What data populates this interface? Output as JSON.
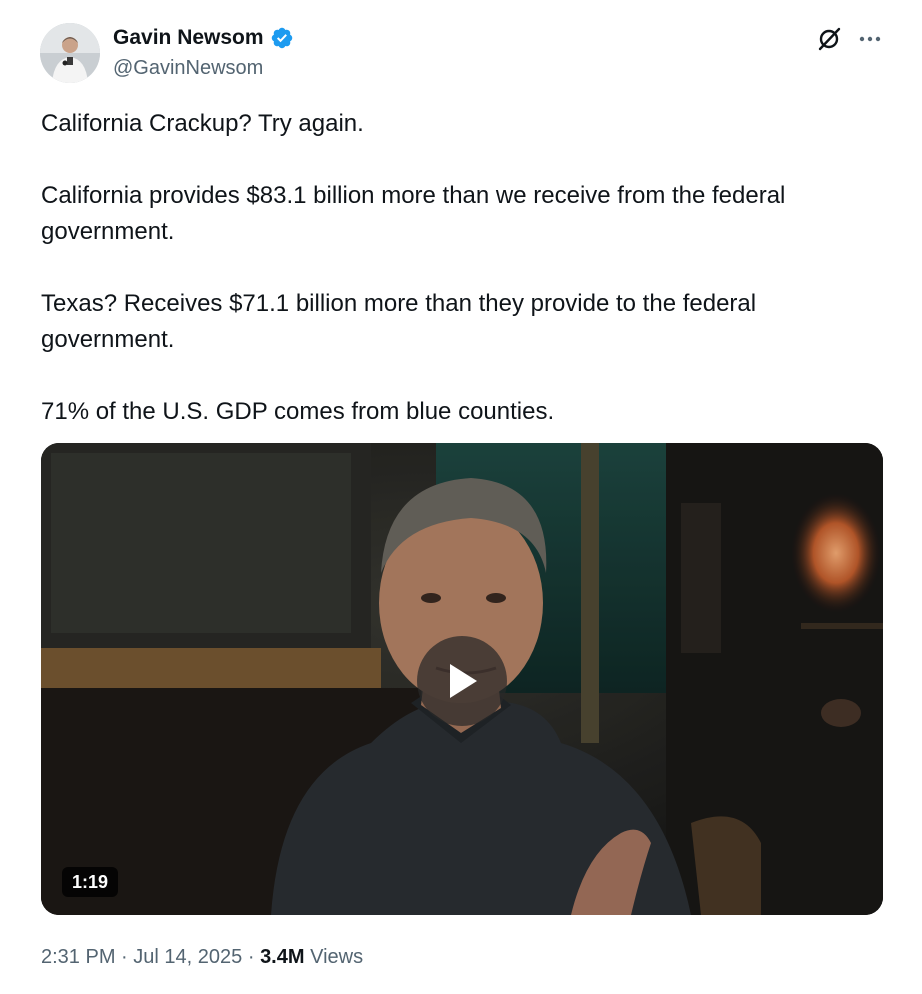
{
  "author": {
    "display_name": "Gavin Newsom",
    "handle": "@GavinNewsom",
    "verified": true,
    "verified_color": "#1d9bf0"
  },
  "icons": {
    "grok": "grok-icon",
    "more": "more-icon",
    "play": "play-icon",
    "verified": "verified-badge-icon"
  },
  "tweet": {
    "paragraphs": [
      "California Crackup? Try again.",
      "California provides $83.1 billion more than we receive from the federal government.",
      "Texas? Receives $71.1 billion more than they provide to the federal government.",
      "71% of the U.S. GDP comes from blue counties."
    ]
  },
  "media": {
    "type": "video",
    "duration": "1:19"
  },
  "meta": {
    "time": "2:31 PM",
    "separator": "·",
    "date": "Jul 14, 2025",
    "views_count": "3.4M",
    "views_label": "Views"
  },
  "colors": {
    "text_primary": "#0f1419",
    "text_secondary": "#536471"
  }
}
